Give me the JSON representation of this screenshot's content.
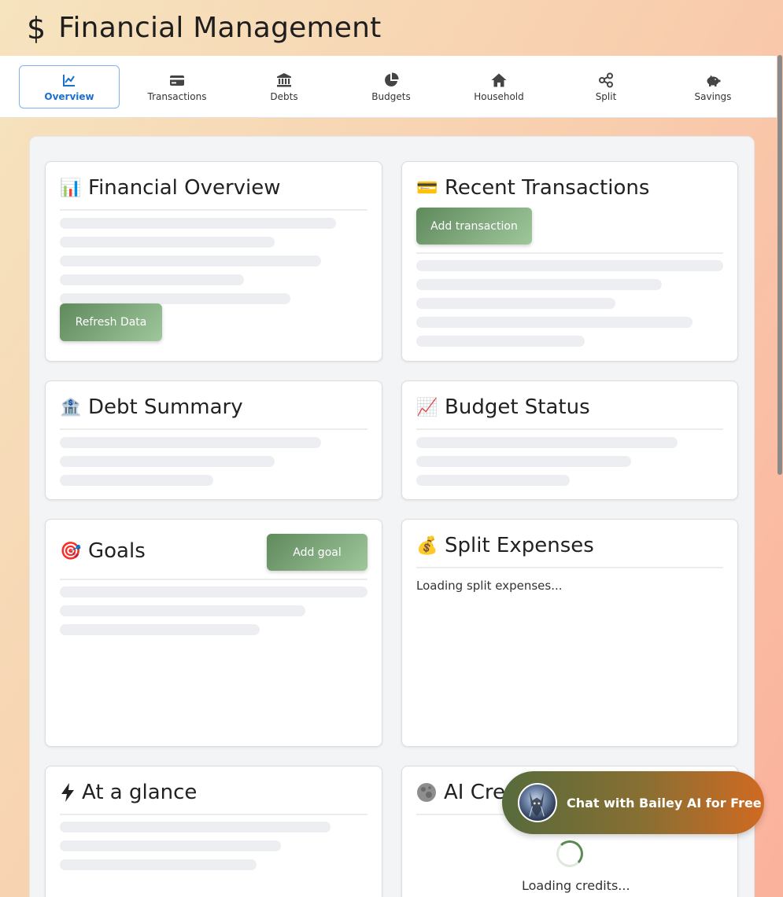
{
  "header": {
    "icon": "dollar-icon",
    "title": "Financial Management"
  },
  "tabs": [
    {
      "label": "Overview",
      "icon": "line-chart-icon",
      "active": true
    },
    {
      "label": "Transactions",
      "icon": "credit-card-icon",
      "active": false
    },
    {
      "label": "Debts",
      "icon": "bank-icon",
      "active": false
    },
    {
      "label": "Budgets",
      "icon": "pie-chart-icon",
      "active": false
    },
    {
      "label": "Household",
      "icon": "home-icon",
      "active": false
    },
    {
      "label": "Split",
      "icon": "share-icon",
      "active": false
    },
    {
      "label": "Savings",
      "icon": "piggy-bank-icon",
      "active": false
    }
  ],
  "cards": {
    "financial_overview": {
      "emoji": "📊",
      "title": "Financial Overview",
      "button": "Refresh Data"
    },
    "recent_transactions": {
      "emoji": "💳",
      "title": "Recent Transactions",
      "button": "Add transaction"
    },
    "debt_summary": {
      "emoji": "🏦",
      "title": "Debt Summary"
    },
    "budget_status": {
      "emoji": "📈",
      "title": "Budget Status"
    },
    "goals": {
      "emoji": "🎯",
      "title": "Goals",
      "button": "Add goal"
    },
    "split_expenses": {
      "emoji": "💰",
      "title": "Split Expenses",
      "loading": "Loading split expenses..."
    },
    "at_a_glance": {
      "icon": "lightning-icon",
      "title": "At a glance"
    },
    "ai_credits": {
      "icon": "moon-icon",
      "title": "AI Cre",
      "loading": "Loading credits..."
    }
  },
  "chat": {
    "label": "Chat with Bailey AI for Free",
    "avatar": "cat-avatar"
  },
  "colors": {
    "accent_blue": "#1a6fd1",
    "button_green": "#5f8a5c",
    "chat_orange": "#d06a22"
  }
}
